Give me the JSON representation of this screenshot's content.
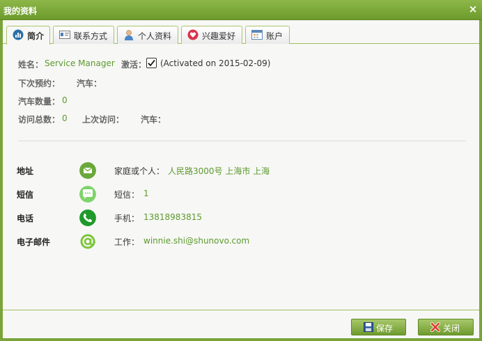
{
  "window": {
    "title": "我的资料",
    "close_glyph": "×"
  },
  "tabs": [
    {
      "label": "简介",
      "icon": "bar-chart-icon",
      "active": true
    },
    {
      "label": "联系方式",
      "icon": "contact-card-icon",
      "active": false
    },
    {
      "label": "个人资料",
      "icon": "person-icon",
      "active": false
    },
    {
      "label": "兴趣爱好",
      "icon": "heart-icon",
      "active": false
    },
    {
      "label": "账户",
      "icon": "calendar-icon",
      "active": false
    }
  ],
  "summary": {
    "name_label": "姓名：",
    "name_value": "Service Manager",
    "activated_label": "激活：",
    "activated_checked": true,
    "activated_text": "(Activated on 2015-02-09)",
    "next_booking_label": "下次预约：",
    "car_label_1": "汽车：",
    "car_count_label": "汽车数量：",
    "car_count_value": "0",
    "visit_total_label": "访问总数：",
    "visit_total_value": "0",
    "last_visit_label": "上次访问：",
    "car_label_2": "汽车："
  },
  "contacts": {
    "address": {
      "label": "地址",
      "icon": "mail-icon",
      "type_label": "家庭或个人：",
      "value": "人民路3000号 上海市 上海"
    },
    "sms": {
      "label": "短信",
      "icon": "chat-bubble-icon",
      "type_label": "短信：",
      "value": "1"
    },
    "phone": {
      "label": "电话",
      "icon": "phone-icon",
      "type_label": "手机：",
      "value": "13818983815"
    },
    "email": {
      "label": "电子邮件",
      "icon": "at-sign-icon",
      "type_label": "工作：",
      "value": "winnie.shi@shunovo.com"
    }
  },
  "footer": {
    "save_label": "保存",
    "close_label": "关闭"
  },
  "colors": {
    "brand": "#7aa33a",
    "link": "#5c9a2f",
    "mail_icon": "#6aa83a",
    "sms_icon": "#7fd36a",
    "phone_icon": "#1f9a2a",
    "email_icon": "#7cc53a"
  }
}
